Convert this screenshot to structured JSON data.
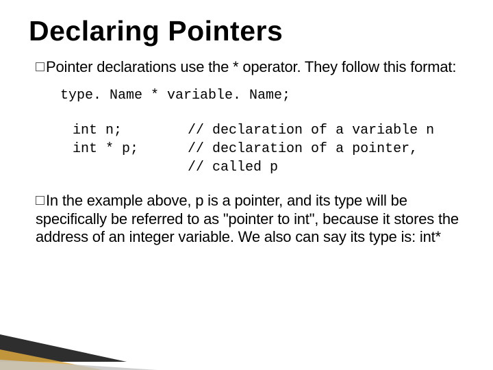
{
  "title": "Declaring Pointers",
  "bullets": [
    {
      "lead": "Pointer",
      "rest": " declarations use the * operator.  They follow this format:"
    },
    {
      "lead": "In",
      "rest": " the example above, p is a pointer, and its type will be specifically be referred to as \"pointer to int\", because it stores the address of an integer variable. We also can say its type is: int*"
    }
  ],
  "code1": "type. Name * variable. Name;",
  "code2": "int n;        // declaration of a variable n\nint * p;      // declaration of a pointer,\n              // called p"
}
